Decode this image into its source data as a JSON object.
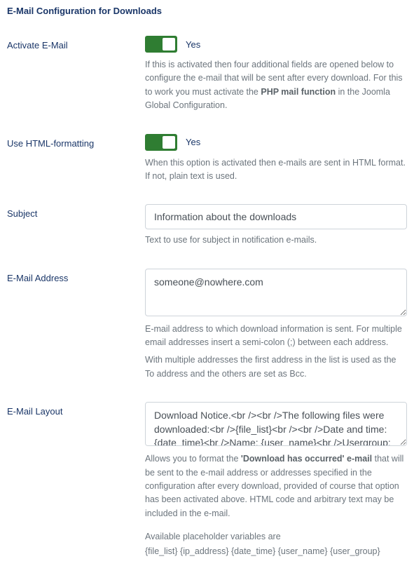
{
  "section_title": "E-Mail Configuration for Downloads",
  "activate": {
    "label": "Activate E-Mail",
    "state_text": "Yes",
    "help_pre": "If this is activated then four additional fields are opened below to configure the e-mail that will be sent after every download. For this to work you must activate the ",
    "help_bold": "PHP mail function",
    "help_post": " in the Joomla Global Configuration."
  },
  "html_format": {
    "label": "Use HTML-formatting",
    "state_text": "Yes",
    "help": "When this option is activated then e-mails are sent in HTML format. If not, plain text is used."
  },
  "subject": {
    "label": "Subject",
    "value": "Information about the downloads",
    "help": "Text to use for subject in notification e-mails."
  },
  "address": {
    "label": "E-Mail Address",
    "value": "someone@nowhere.com",
    "help1": "E-mail address to which download information is sent. For multiple email addresses insert a semi-colon (;) between each address.",
    "help2": "With multiple addresses the first address in the list is used as the To address and the others are set as Bcc."
  },
  "layout": {
    "label": "E-Mail Layout",
    "value": "Download Notice.<br /><br />The following files were downloaded:<br />{file_list}<br /><br />Date and time: {date_time}<br />Name: {user_name}<br />Usergroup: {user_group}<br />IP address: {ip_address}",
    "help_pre": "Allows you to format the ",
    "help_bold": "'Download has occurred' e-mail",
    "help_post": " that will be sent to the e-mail address or addresses specified in the configuration after every download, provided of course that option has been activated above. HTML code and arbitrary text may be included in the e-mail.",
    "help2": "Available placeholder variables are",
    "help3": "{file_list} {ip_address} {date_time} {user_name} {user_group}"
  }
}
